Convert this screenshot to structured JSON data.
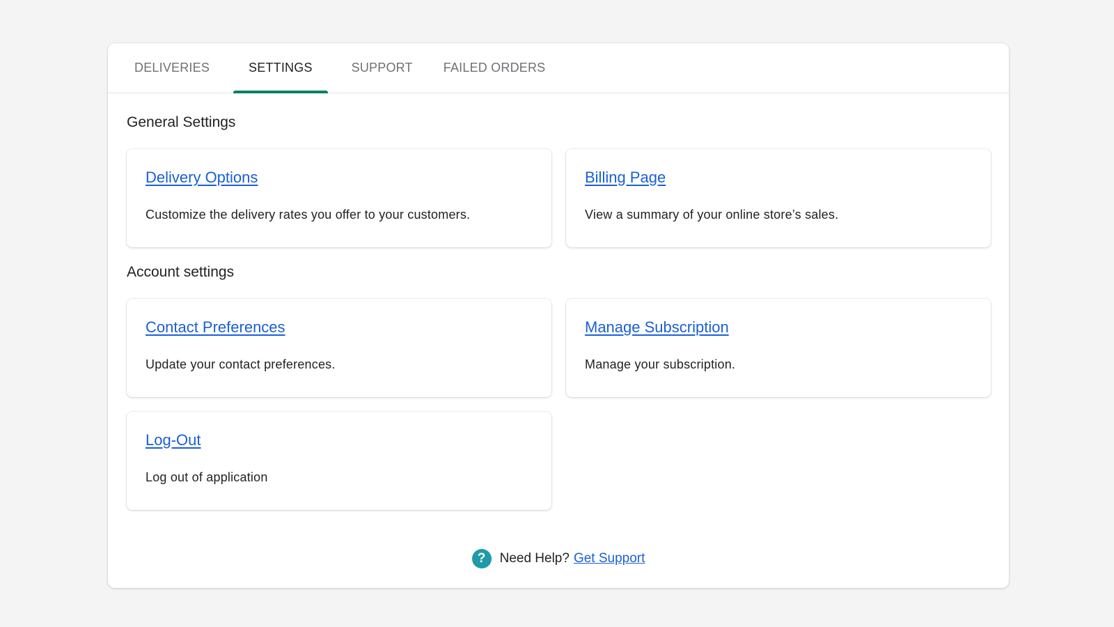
{
  "tabs": [
    {
      "label": "DELIVERIES",
      "active": false
    },
    {
      "label": "SETTINGS",
      "active": true
    },
    {
      "label": "SUPPORT",
      "active": false
    },
    {
      "label": "FAILED ORDERS",
      "active": false
    }
  ],
  "general": {
    "title": "General Settings",
    "cards": [
      {
        "link": "Delivery Options",
        "description": "Customize the delivery rates you offer to your customers."
      },
      {
        "link": "Billing Page",
        "description": "View a summary of your online store’s sales."
      }
    ]
  },
  "account": {
    "title": "Account settings",
    "cards": [
      {
        "link": "Contact Preferences",
        "description": "Update your contact preferences."
      },
      {
        "link": "Manage Subscription",
        "description": "Manage your subscription."
      },
      {
        "link": "Log-Out",
        "description": "Log out of application"
      }
    ]
  },
  "help": {
    "icon": "question-circle-icon",
    "icon_glyph": "?",
    "text": "Need Help?",
    "link": "Get Support"
  },
  "colors": {
    "accent": "#008060",
    "link": "#1a5fd6",
    "help_icon": "#1f9aa8"
  }
}
